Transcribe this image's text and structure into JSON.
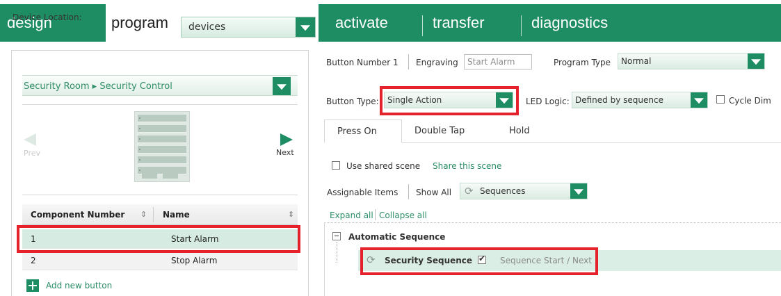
{
  "nav": {
    "design": "design",
    "program": "program",
    "devices_select": "devices",
    "activate": "activate",
    "transfer": "transfer",
    "diagnostics": "diagnostics"
  },
  "left": {
    "device_location_label": "Device Location:",
    "location_value": "Security Room ▸ Security Control",
    "prev": "Prev",
    "next": "Next",
    "table": {
      "col_component": "Component Number",
      "col_name": "Name",
      "rows": [
        {
          "number": "1",
          "name": "Start Alarm"
        },
        {
          "number": "2",
          "name": "Stop Alarm"
        }
      ]
    },
    "add_button": "Add new button"
  },
  "right": {
    "button_number": "Button Number 1",
    "engraving_label": "Engraving",
    "engraving_value": "Start Alarm",
    "program_type_label": "Program Type",
    "program_type_value": "Normal",
    "button_type_label": "Button Type:",
    "button_type_value": "Single Action",
    "led_logic_label": "LED Logic:",
    "led_logic_value": "Defined by sequence",
    "cycle_dim_label": "Cycle Dim",
    "tabs": [
      "Press On",
      "Double Tap",
      "Hold"
    ],
    "use_shared_scene": "Use shared scene",
    "share_scene_link": "Share this scene",
    "assignable_items": "Assignable Items",
    "show_all": "Show All",
    "sequences_select": "Sequences",
    "expand_all": "Expand all",
    "collapse_all": "Collapse all",
    "tree": {
      "group": "Automatic Sequence",
      "item": "Security Sequence",
      "item_detail": "Sequence Start / Next"
    }
  },
  "colors": {
    "brand_green": "#1f8d64",
    "highlight_red": "#e4222c",
    "selected_row": "#d6ece2"
  },
  "icons": [
    "chevron-down-icon",
    "prev-arrow-icon",
    "next-arrow-icon",
    "sort-icon",
    "add-icon",
    "refresh-icon",
    "checkbox-icon",
    "collapse-minus-icon"
  ]
}
